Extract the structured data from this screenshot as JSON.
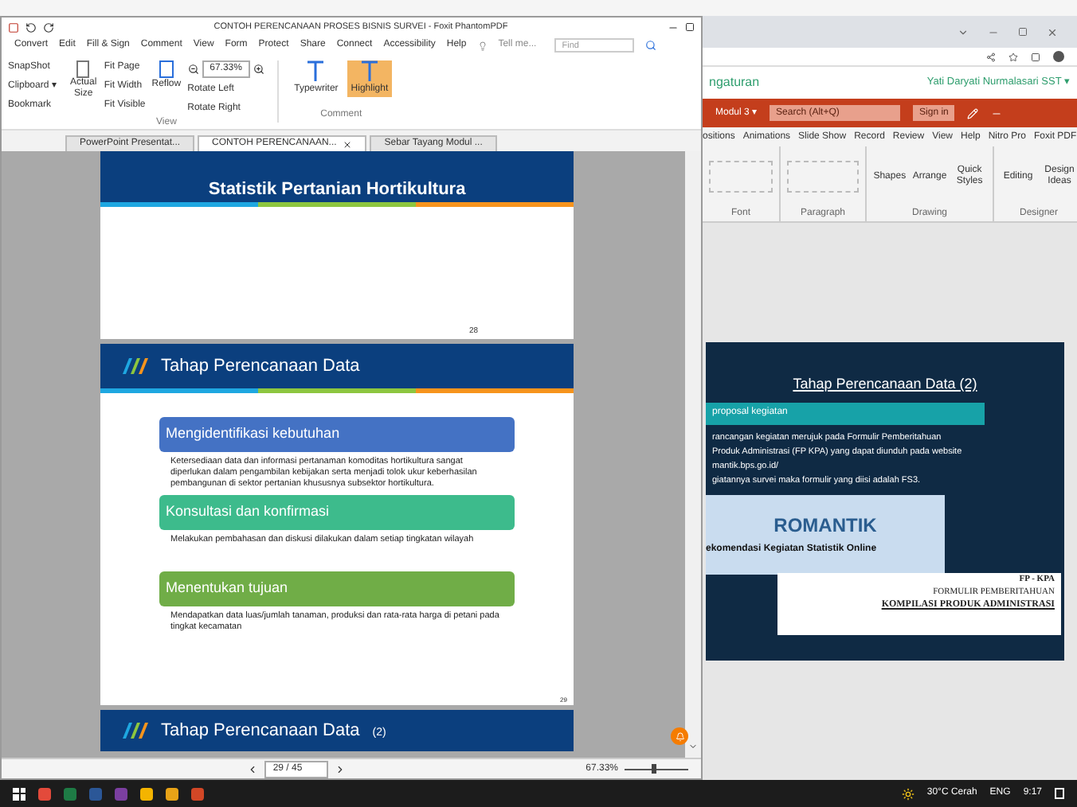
{
  "foxit": {
    "title": "CONTOH PERENCANAAN PROSES BISNIS SURVEI - Foxit PhantomPDF",
    "menu": [
      "Convert",
      "Edit",
      "Fill & Sign",
      "Comment",
      "View",
      "Form",
      "Protect",
      "Share",
      "Connect",
      "Accessibility",
      "Help"
    ],
    "tell_me": "Tell me...",
    "find_placeholder": "Find",
    "ribbon": {
      "left": [
        "SnapShot",
        "Clipboard ▾",
        "Bookmark"
      ],
      "actual_size": "Actual Size",
      "fit": [
        "Fit Page",
        "Fit Width",
        "Fit Visible"
      ],
      "reflow": "Reflow",
      "zoom": "67.33%",
      "rotate": [
        "Rotate Left",
        "Rotate Right"
      ],
      "view_group": "View",
      "comment_group": "Comment",
      "tools": [
        {
          "label": "Typewriter",
          "selected": false
        },
        {
          "label": "Highlight",
          "selected": true
        }
      ]
    },
    "doc_tabs": [
      {
        "label": "PowerPoint Presentat...",
        "selected": false
      },
      {
        "label": "CONTOH PERENCANAAN...",
        "selected": true
      },
      {
        "label": "Sebar Tayang Modul ...",
        "selected": false
      }
    ],
    "pages": [
      {
        "title": "Statistik Pertanian Hortikultura",
        "number": "28"
      },
      {
        "title": "Tahap Perencanaan Data",
        "number": "29",
        "steps": [
          {
            "heading": "Mengidentifikasi kebutuhan",
            "text": "Ketersediaan data dan informasi pertanaman komoditas hortikultura sangat diperlukan dalam pengambilan kebijakan serta menjadi tolok ukur keberhasilan pembangunan di sektor pertanian khususnya subsektor hortikultura.",
            "color": "#4472c4"
          },
          {
            "heading": "Konsultasi dan konfirmasi",
            "text": "Melakukan pembahasan dan diskusi dilakukan dalam setiap tingkatan wilayah",
            "color": "#3dbb8c"
          },
          {
            "heading": "Menentukan tujuan",
            "text": "Mendapatkan data luas/jumlah tanaman, produksi dan rata-rata harga di petani pada tingkat kecamatan",
            "color": "#70ad47"
          }
        ]
      },
      {
        "title": "Tahap Perencanaan Data",
        "suffix": "(2)"
      }
    ],
    "status": {
      "page": "29 / 45",
      "zoom": "67.33%",
      "zoom_slider": {
        "level": 0.45
      }
    }
  },
  "browser": {
    "header_left": "ngaturan",
    "user": "Yati Daryati Nurmalasari SST ▾",
    "powerpoint": {
      "file": "Modul 3 ▾",
      "search": "Search (Alt+Q)",
      "sign_in": "Sign in",
      "tabs": [
        "ositions",
        "Animations",
        "Slide Show",
        "Record",
        "Review",
        "View",
        "Help",
        "Nitro Pro",
        "Foxit PDF"
      ],
      "groups": [
        "Font",
        "Paragraph",
        "Drawing",
        "Designer"
      ],
      "buttons": [
        "Shapes",
        "Arrange",
        "Quick Styles",
        "Editing",
        "Design Ideas"
      ],
      "slide": {
        "title": "Tahap Perencanaan Data (2)",
        "bar": "proposal kegiatan",
        "lines": [
          "rancangan kegiatan merujuk pada Formulir Pemberitahuan",
          "Produk Administrasi (FP KPA) yang dapat diunduh pada website",
          "mantik.bps.go.id/",
          "giatannya survei maka formulir yang diisi adalah FS3."
        ],
        "logo": "ROMANTIK",
        "tagline": "ekomendasi Kegiatan Statistik Online",
        "form": [
          "FP - KPA",
          "FORMULIR PEMBERITAHUAN",
          "KOMPILASI PRODUK ADMINISTRASI"
        ]
      }
    }
  },
  "taskbar": {
    "weather": "30°C Cerah",
    "language": "ENG",
    "time": "9:17"
  }
}
